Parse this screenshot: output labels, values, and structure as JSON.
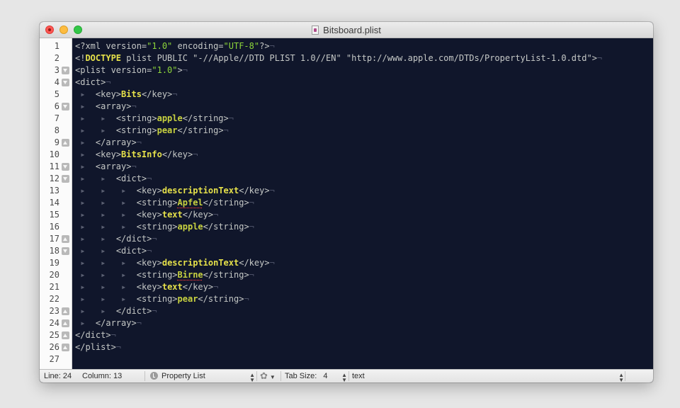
{
  "window": {
    "title": "Bitsboard.plist"
  },
  "editor": {
    "lines": [
      {
        "n": "1",
        "fold": ""
      },
      {
        "n": "2",
        "fold": ""
      },
      {
        "n": "3",
        "fold": "down"
      },
      {
        "n": "4",
        "fold": "down"
      },
      {
        "n": "5",
        "fold": ""
      },
      {
        "n": "6",
        "fold": "down"
      },
      {
        "n": "7",
        "fold": ""
      },
      {
        "n": "8",
        "fold": ""
      },
      {
        "n": "9",
        "fold": "up"
      },
      {
        "n": "10",
        "fold": ""
      },
      {
        "n": "11",
        "fold": "down"
      },
      {
        "n": "12",
        "fold": "down"
      },
      {
        "n": "13",
        "fold": ""
      },
      {
        "n": "14",
        "fold": ""
      },
      {
        "n": "15",
        "fold": ""
      },
      {
        "n": "16",
        "fold": ""
      },
      {
        "n": "17",
        "fold": "up"
      },
      {
        "n": "18",
        "fold": "down"
      },
      {
        "n": "19",
        "fold": ""
      },
      {
        "n": "20",
        "fold": ""
      },
      {
        "n": "21",
        "fold": ""
      },
      {
        "n": "22",
        "fold": ""
      },
      {
        "n": "23",
        "fold": "up"
      },
      {
        "n": "24",
        "fold": "up"
      },
      {
        "n": "25",
        "fold": "up"
      },
      {
        "n": "26",
        "fold": "up"
      },
      {
        "n": "27",
        "fold": ""
      }
    ],
    "code": [
      {
        "indent": 0,
        "eol": true,
        "parts": [
          {
            "t": "<?xml version="
          },
          {
            "t": "\"1.0\"",
            "c": "s"
          },
          {
            "t": " encoding="
          },
          {
            "t": "\"UTF-8\"",
            "c": "s"
          },
          {
            "t": "?>"
          }
        ]
      },
      {
        "indent": 0,
        "eol": true,
        "parts": [
          {
            "t": "<!"
          },
          {
            "t": "DOCTYPE",
            "c": "k"
          },
          {
            "t": " plist PUBLIC \"-//Apple//DTD PLIST 1.0//EN\" \"http://www.apple.com/DTDs/PropertyList-1.0.dtd\">"
          }
        ]
      },
      {
        "indent": 0,
        "eol": true,
        "parts": [
          {
            "t": "<plist version="
          },
          {
            "t": "\"1.0\"",
            "c": "s"
          },
          {
            "t": ">"
          }
        ]
      },
      {
        "indent": 0,
        "eol": true,
        "parts": [
          {
            "t": "<dict>"
          }
        ]
      },
      {
        "indent": 1,
        "eol": true,
        "parts": [
          {
            "t": "<key>"
          },
          {
            "t": "Bits",
            "c": "k"
          },
          {
            "t": "</key>"
          }
        ]
      },
      {
        "indent": 1,
        "eol": true,
        "parts": [
          {
            "t": "<array>"
          }
        ]
      },
      {
        "indent": 2,
        "eol": true,
        "parts": [
          {
            "t": "<string>"
          },
          {
            "t": "apple",
            "c": "bl"
          },
          {
            "t": "</string>"
          }
        ]
      },
      {
        "indent": 2,
        "eol": true,
        "parts": [
          {
            "t": "<string>"
          },
          {
            "t": "pear",
            "c": "bl"
          },
          {
            "t": "</string>"
          }
        ]
      },
      {
        "indent": 1,
        "eol": true,
        "parts": [
          {
            "t": "</array>"
          }
        ]
      },
      {
        "indent": 1,
        "eol": true,
        "parts": [
          {
            "t": "<key>"
          },
          {
            "t": "BitsInfo",
            "c": "k"
          },
          {
            "t": "</key>"
          }
        ]
      },
      {
        "indent": 1,
        "eol": true,
        "parts": [
          {
            "t": "<array>"
          }
        ]
      },
      {
        "indent": 2,
        "eol": true,
        "parts": [
          {
            "t": "<dict>"
          }
        ]
      },
      {
        "indent": 3,
        "eol": true,
        "parts": [
          {
            "t": "<key>"
          },
          {
            "t": "descriptionText",
            "c": "k"
          },
          {
            "t": "</key>"
          }
        ]
      },
      {
        "indent": 3,
        "eol": true,
        "parts": [
          {
            "t": "<string>"
          },
          {
            "t": "Apfel",
            "c": "bl sp"
          },
          {
            "t": "</string>"
          }
        ]
      },
      {
        "indent": 3,
        "eol": true,
        "parts": [
          {
            "t": "<key>"
          },
          {
            "t": "text",
            "c": "k"
          },
          {
            "t": "</key>"
          }
        ]
      },
      {
        "indent": 3,
        "eol": true,
        "parts": [
          {
            "t": "<string>"
          },
          {
            "t": "apple",
            "c": "bl"
          },
          {
            "t": "</string>"
          }
        ]
      },
      {
        "indent": 2,
        "eol": true,
        "parts": [
          {
            "t": "</dict>"
          }
        ]
      },
      {
        "indent": 2,
        "eol": true,
        "parts": [
          {
            "t": "<dict>"
          }
        ]
      },
      {
        "indent": 3,
        "eol": true,
        "parts": [
          {
            "t": "<key>"
          },
          {
            "t": "descriptionText",
            "c": "k"
          },
          {
            "t": "</key>"
          }
        ]
      },
      {
        "indent": 3,
        "eol": true,
        "parts": [
          {
            "t": "<string>"
          },
          {
            "t": "Birne",
            "c": "bl sp"
          },
          {
            "t": "</string>"
          }
        ]
      },
      {
        "indent": 3,
        "eol": true,
        "parts": [
          {
            "t": "<key>"
          },
          {
            "t": "text",
            "c": "k"
          },
          {
            "t": "</key>"
          }
        ]
      },
      {
        "indent": 3,
        "eol": true,
        "parts": [
          {
            "t": "<string>"
          },
          {
            "t": "pear",
            "c": "bl"
          },
          {
            "t": "</string>"
          }
        ]
      },
      {
        "indent": 2,
        "eol": true,
        "parts": [
          {
            "t": "</dict>"
          }
        ]
      },
      {
        "indent": 1,
        "eol": true,
        "parts": [
          {
            "t": "</array>"
          }
        ]
      },
      {
        "indent": 0,
        "eol": true,
        "parts": [
          {
            "t": "</dict>"
          }
        ]
      },
      {
        "indent": 0,
        "eol": true,
        "parts": [
          {
            "t": "</plist>"
          }
        ]
      },
      {
        "indent": 0,
        "eol": false,
        "parts": []
      }
    ]
  },
  "statusbar": {
    "line_label": "Line:",
    "line_value": "24",
    "column_label": "Column:",
    "column_value": "13",
    "syntax": "Property List",
    "tab_size_label": "Tab Size:",
    "tab_size_value": "4",
    "symbol": "text"
  },
  "colors": {
    "editor_bg": "#10162b",
    "string": "#8dd63a",
    "keyword": "#e6e14a",
    "plain": "#c5c8c6"
  },
  "icons": {
    "file": "plist-document-icon",
    "syntax": "checkmark-circle-icon",
    "settings": "gear-icon",
    "stepper": "up-down-arrows-icon"
  }
}
